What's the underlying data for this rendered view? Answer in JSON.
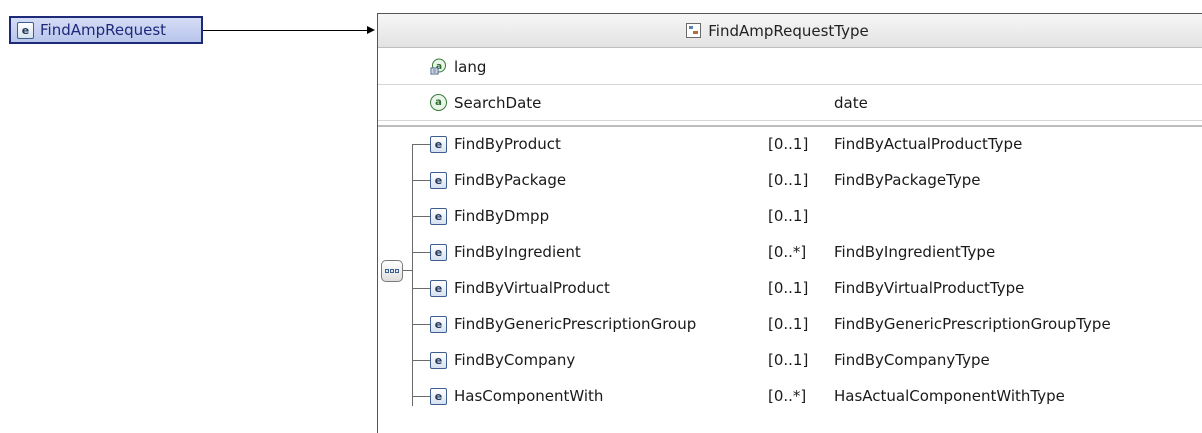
{
  "root": {
    "badge": "e",
    "label": "FindAmpRequest"
  },
  "type_box": {
    "title": "FindAmpRequestType"
  },
  "attributes": [
    {
      "badge": "a",
      "name": "lang",
      "type": "",
      "icon": "any-attribute-icon"
    },
    {
      "badge": "a",
      "name": "SearchDate",
      "type": "date",
      "icon": "attribute-icon"
    }
  ],
  "children": [
    {
      "badge": "e",
      "name": "FindByProduct",
      "cardinality": "[0..1]",
      "type": "FindByActualProductType"
    },
    {
      "badge": "e",
      "name": "FindByPackage",
      "cardinality": "[0..1]",
      "type": "FindByPackageType"
    },
    {
      "badge": "e",
      "name": "FindByDmpp",
      "cardinality": "[0..1]",
      "type": ""
    },
    {
      "badge": "e",
      "name": "FindByIngredient",
      "cardinality": "[0..*]",
      "type": "FindByIngredientType"
    },
    {
      "badge": "e",
      "name": "FindByVirtualProduct",
      "cardinality": "[0..1]",
      "type": "FindByVirtualProductType"
    },
    {
      "badge": "e",
      "name": "FindByGenericPrescriptionGroup",
      "cardinality": "[0..1]",
      "type": "FindByGenericPrescriptionGroupType"
    },
    {
      "badge": "e",
      "name": "FindByCompany",
      "cardinality": "[0..1]",
      "type": "FindByCompanyType"
    },
    {
      "badge": "e",
      "name": "HasComponentWith",
      "cardinality": "[0..*]",
      "type": "HasActualComponentWithType"
    }
  ],
  "colors": {
    "root_border": "#1d2a7a",
    "root_fill": "#c7d0f0",
    "element_badge": "#3e5f8e",
    "attribute_badge": "#3a7a3a"
  }
}
